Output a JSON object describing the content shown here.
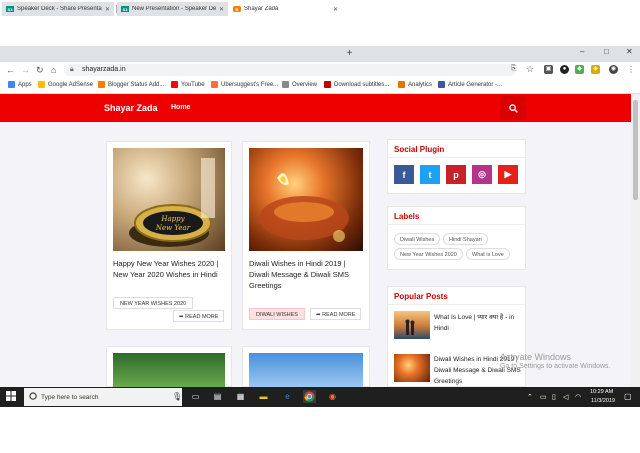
{
  "browser": {
    "tabs": [
      {
        "icon": "speakerdeck-icon",
        "favicon_text": "S3",
        "favicon_color": "#009287",
        "label": "Speaker Deck - Share Presentatio"
      },
      {
        "icon": "speakerdeck-icon",
        "favicon_text": "S3",
        "favicon_color": "#009287",
        "label": "New Presentation - Speaker Deck"
      },
      {
        "icon": "blogger-icon",
        "favicon_text": "B",
        "favicon_color": "#f57d00",
        "label": "Shayar Zada"
      }
    ],
    "new_tab": "+",
    "window_controls": [
      "–",
      "□",
      "✕"
    ],
    "url": "shayarzada.in",
    "bookmarks": [
      {
        "label": "Apps",
        "color": "#4285f4"
      },
      {
        "label": "Google AdSense",
        "color": "#fbbc05"
      },
      {
        "label": "Blogger Status Add...",
        "color": "#f57d00"
      },
      {
        "label": "YouTube",
        "color": "#ff0000"
      },
      {
        "label": "Ubersuggest's Free...",
        "color": "#ff6b3d"
      },
      {
        "label": "Overview",
        "color": "#888888"
      },
      {
        "label": "Download subtitles...",
        "color": "#c00000"
      },
      {
        "label": "Analytics",
        "color": "#e37400"
      },
      {
        "label": "Article Generator -...",
        "color": "#3b5998"
      }
    ]
  },
  "site": {
    "title": "Shayar Zada",
    "nav_home": "Home",
    "brand_color": "#ee0000",
    "posts": [
      {
        "title": "Happy New Year Wishes 2020 | New Year 2020 Wishes in Hindi",
        "tag": "NEW YEAR WISHES 2020",
        "more": "READ MORE"
      },
      {
        "title": "Diwali Wishes in Hindi 2019 | Diwali Message & Diwali SMS Greetings",
        "tag": "DIWALI WISHES",
        "more": "READ MORE"
      }
    ],
    "sidebar": {
      "social_title": "Social Plugin",
      "social": [
        {
          "icon": "facebook-icon",
          "glyph": "f",
          "color": "#3b5998"
        },
        {
          "icon": "twitter-icon",
          "glyph": "t",
          "color": "#1da1f2"
        },
        {
          "icon": "pinterest-icon",
          "glyph": "p",
          "color": "#cb2027"
        },
        {
          "icon": "instagram-icon",
          "glyph": "◎",
          "color": "#b5338a"
        },
        {
          "icon": "youtube-icon",
          "glyph": "▶",
          "color": "#e62117"
        }
      ],
      "labels_title": "Labels",
      "labels": [
        "Diwali Wishes",
        "Hindi Shayari",
        "New Year Wishes 2020",
        "What is Love"
      ],
      "popular_title": "Popular Posts",
      "popular": [
        {
          "title": "What Is Love | प्यार क्या है - in Hindi"
        },
        {
          "title": "Diwali Wishes in Hindi 2019 | Diwali Message & Diwali SMS Greetings"
        }
      ]
    }
  },
  "watermark": {
    "line1": "Activate Windows",
    "line2": "Go to Settings to activate Windows."
  },
  "taskbar": {
    "search_placeholder": "Type here to search",
    "time": "10:29 AM",
    "date": "11/3/2019"
  }
}
